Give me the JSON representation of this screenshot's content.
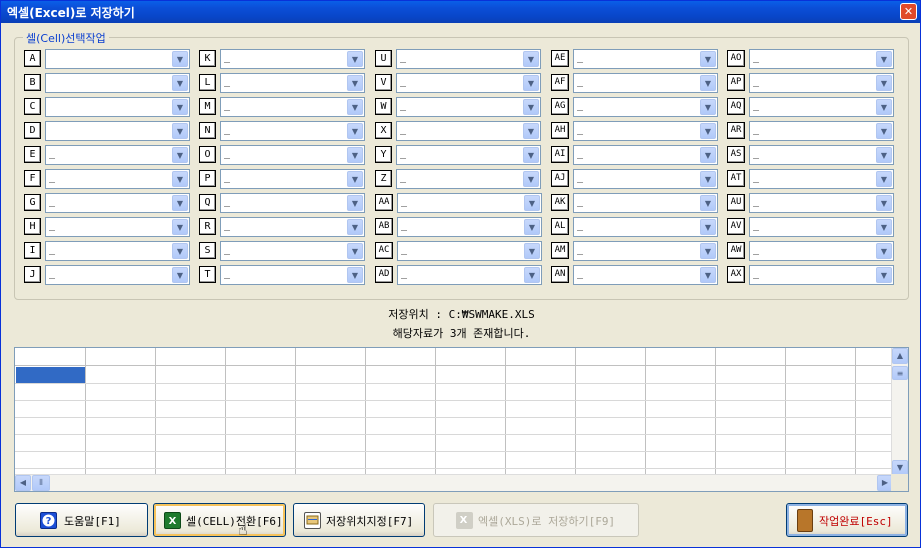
{
  "window": {
    "title": "엑셀(Excel)로 저장하기",
    "close_glyph": "✕"
  },
  "group": {
    "title": "셀(Cell)선택작업"
  },
  "cells": [
    {
      "label": "A",
      "value": ""
    },
    {
      "label": "B",
      "value": ""
    },
    {
      "label": "C",
      "value": ""
    },
    {
      "label": "D",
      "value": ""
    },
    {
      "label": "E",
      "value": "_"
    },
    {
      "label": "F",
      "value": "_"
    },
    {
      "label": "G",
      "value": "_"
    },
    {
      "label": "H",
      "value": "_"
    },
    {
      "label": "I",
      "value": "_"
    },
    {
      "label": "J",
      "value": "_"
    },
    {
      "label": "K",
      "value": "_"
    },
    {
      "label": "L",
      "value": "_"
    },
    {
      "label": "M",
      "value": "_"
    },
    {
      "label": "N",
      "value": "_"
    },
    {
      "label": "O",
      "value": "_"
    },
    {
      "label": "P",
      "value": "_"
    },
    {
      "label": "Q",
      "value": "_"
    },
    {
      "label": "R",
      "value": "_"
    },
    {
      "label": "S",
      "value": "_"
    },
    {
      "label": "T",
      "value": "_"
    },
    {
      "label": "U",
      "value": "_"
    },
    {
      "label": "V",
      "value": "_"
    },
    {
      "label": "W",
      "value": "_"
    },
    {
      "label": "X",
      "value": "_"
    },
    {
      "label": "Y",
      "value": "_"
    },
    {
      "label": "Z",
      "value": "_"
    },
    {
      "label": "AA",
      "value": "_"
    },
    {
      "label": "AB",
      "value": "_"
    },
    {
      "label": "AC",
      "value": "_"
    },
    {
      "label": "AD",
      "value": "_"
    },
    {
      "label": "AE",
      "value": "_"
    },
    {
      "label": "AF",
      "value": "_"
    },
    {
      "label": "AG",
      "value": "_"
    },
    {
      "label": "AH",
      "value": "_"
    },
    {
      "label": "AI",
      "value": "_"
    },
    {
      "label": "AJ",
      "value": "_"
    },
    {
      "label": "AK",
      "value": "_"
    },
    {
      "label": "AL",
      "value": "_"
    },
    {
      "label": "AM",
      "value": "_"
    },
    {
      "label": "AN",
      "value": "_"
    },
    {
      "label": "AO",
      "value": "_"
    },
    {
      "label": "AP",
      "value": "_"
    },
    {
      "label": "AQ",
      "value": "_"
    },
    {
      "label": "AR",
      "value": "_"
    },
    {
      "label": "AS",
      "value": "_"
    },
    {
      "label": "AT",
      "value": "_"
    },
    {
      "label": "AU",
      "value": "_"
    },
    {
      "label": "AV",
      "value": "_"
    },
    {
      "label": "AW",
      "value": "_"
    },
    {
      "label": "AX",
      "value": "_"
    }
  ],
  "info": {
    "save_location": "저장위치 : C:₩SWMAKE.XLS",
    "record_count": "해당자료가 3개 존재합니다."
  },
  "buttons": {
    "help": "도움말[F1]",
    "cell_switch": "셀(CELL)전환[F6]",
    "set_location": "저장위치지정[F7]",
    "save_xls": "엑셀(XLS)로 저장하기[F9]",
    "done": "작업완료[Esc]"
  },
  "colors": {
    "accent": "#316ac5",
    "title_bar": "#0a5fe8",
    "done_text": "#c00000"
  }
}
